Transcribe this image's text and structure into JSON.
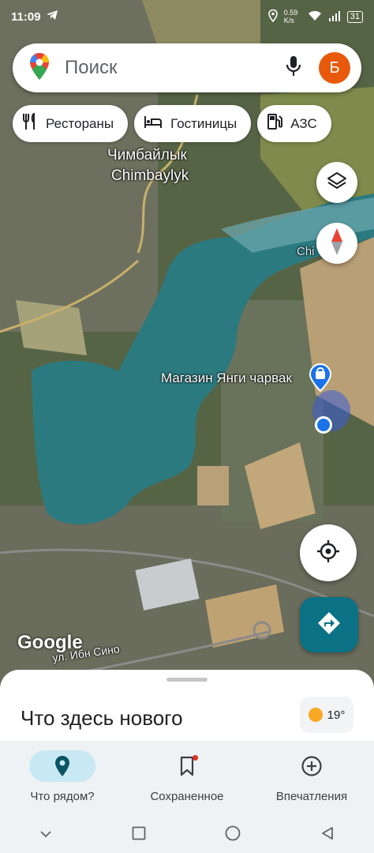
{
  "status_bar": {
    "time": "11:09",
    "network_speed": "0.59 K/s",
    "battery": "31"
  },
  "search": {
    "placeholder": "Поиск",
    "avatar_letter": "Б"
  },
  "chips": [
    {
      "label": "Рестораны",
      "icon": "restaurant-icon"
    },
    {
      "label": "Гостиницы",
      "icon": "hotel-icon"
    },
    {
      "label": "АЗС",
      "icon": "gas-station-icon"
    }
  ],
  "map": {
    "place_label_ru": "Чимбайлык",
    "place_label_en": "Chimbaylyk",
    "river_label": "Chi",
    "store_label": "Магазин Янги чарвак",
    "street_label": "ул. Ибн Сино",
    "google_logo": "Google"
  },
  "sheet": {
    "title": "Что здесь нового",
    "temperature": "19°"
  },
  "bottom_nav": [
    {
      "label": "Что рядом?",
      "icon": "explore-pin-icon",
      "active": true
    },
    {
      "label": "Сохраненное",
      "icon": "bookmark-icon",
      "active": false
    },
    {
      "label": "Впечатления",
      "icon": "add-circle-icon",
      "active": false
    }
  ],
  "colors": {
    "accent": "#0b7285",
    "avatar": "#e8590c",
    "water": "#2b7a80",
    "active_nav": "#c8e9f4"
  }
}
